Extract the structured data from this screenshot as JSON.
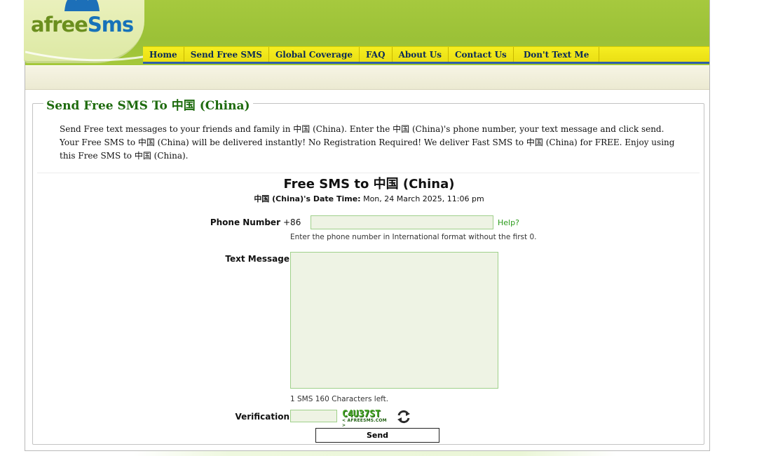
{
  "logo": {
    "text_a": "afree",
    "text_b": "Sms"
  },
  "nav": {
    "items": [
      {
        "label": "Home"
      },
      {
        "label": "Send Free SMS"
      },
      {
        "label": "Global Coverage"
      },
      {
        "label": "FAQ"
      },
      {
        "label": "About Us"
      },
      {
        "label": "Contact Us"
      },
      {
        "label": "Don't Text Me"
      }
    ]
  },
  "section": {
    "legend": "Send Free SMS To 中国 (China)",
    "intro": "Send Free text messages to your friends and family in 中国 (China). Enter the 中国 (China)'s phone number, your text message and click send. Your Free SMS to 中国 (China) will be delivered instantly! No Registration Required! We deliver Fast SMS to 中国 (China) for FREE. Enjoy using this Free SMS to 中国 (China)."
  },
  "form": {
    "title": "Free SMS to 中国 (China)",
    "datetime_label": "中国 (China)'s Date Time:",
    "datetime_value": "Mon, 24 March 2025, 11:06 pm",
    "phone_label": "Phone Number",
    "phone_prefix": "+86",
    "phone_value": "",
    "help_label": "Help?",
    "phone_hint": "Enter the phone number in International format without the first 0.",
    "message_label": "Text Message",
    "message_value": "",
    "chars_left": "1 SMS 160 Characters left.",
    "verification_label": "Verification",
    "verification_value": "",
    "captcha_code": "C4U37ST",
    "captcha_domain": "< AFREESMS.COM >",
    "send_label": "Send"
  },
  "colors": {
    "header_green": "#9bc137",
    "nav_yellow": "#f6ee21",
    "legend_green": "#1e6b0e",
    "link_green": "#2a9a1a",
    "input_bg": "#eef3e4"
  }
}
